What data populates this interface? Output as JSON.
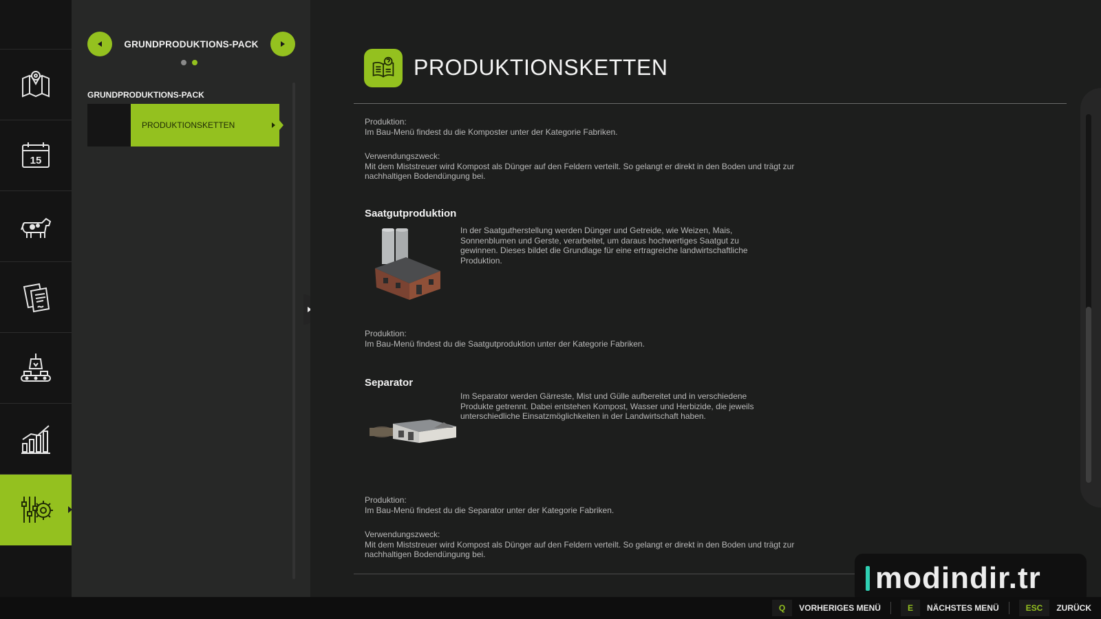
{
  "sidebar": {
    "items": [
      {
        "id": "map",
        "icon": "map-pin-icon"
      },
      {
        "id": "calendar",
        "icon": "calendar-icon",
        "day": "15"
      },
      {
        "id": "animals",
        "icon": "cow-icon"
      },
      {
        "id": "contracts",
        "icon": "contract-icon"
      },
      {
        "id": "production",
        "icon": "factory-conveyor-icon"
      },
      {
        "id": "statistics",
        "icon": "bar-chart-icon"
      },
      {
        "id": "settings",
        "icon": "settings-gear-icon",
        "active": true
      }
    ]
  },
  "subpanel": {
    "pager_title": "GRUNDPRODUKTIONS-PACK",
    "section_label": "GRUNDPRODUKTIONS-PACK",
    "list_item_label": "PRODUKTIONSKETTEN"
  },
  "main": {
    "title": "PRODUKTIONSKETTEN",
    "block1": {
      "prod_label": "Produktion:",
      "prod_text": "Im Bau-Menü findest du die Komposter unter der Kategorie Fabriken.",
      "use_label": "Verwendungszweck:",
      "use_text": "Mit dem Miststreuer wird Kompost als Dünger auf den Feldern verteilt. So gelangt er direkt in den Boden und trägt zur nachhaltigen Bodendüngung bei."
    },
    "saatgut": {
      "title": "Saatgutproduktion",
      "desc": "In der Saatgutherstellung werden Dünger und Getreide, wie Weizen, Mais, Sonnenblumen und Gerste, verarbeitet, um daraus hochwertiges Saatgut zu gewinnen. Dieses bildet die Grundlage für eine ertragreiche landwirtschaftliche Produktion.",
      "prod_label": "Produktion:",
      "prod_text": "Im Bau-Menü findest du die Saatgutproduktion unter der Kategorie Fabriken."
    },
    "separator": {
      "title": "Separator",
      "desc": "Im Separator werden Gärreste, Mist und Gülle aufbereitet und in verschiedene Produkte getrennt. Dabei entstehen Kompost, Wasser und Herbizide, die jeweils unterschiedliche Einsatzmöglichkeiten in der Landwirtschaft haben.",
      "prod_label": "Produktion:",
      "prod_text": "Im Bau-Menü findest du die Separator unter der Kategorie Fabriken.",
      "use_label": "Verwendungszweck:",
      "use_text": "Mit dem Miststreuer wird Kompost als Dünger auf den Feldern verteilt. So gelangt er direkt in den Boden und trägt zur nachhaltigen Bodendüngung bei."
    }
  },
  "watermark": {
    "text": "modindir.tr"
  },
  "bottombar": {
    "hints": [
      {
        "key": "Q",
        "label": "VORHERIGES MENÜ"
      },
      {
        "key": "E",
        "label": "NÄCHSTES MENÜ"
      },
      {
        "key": "ESC",
        "label": "ZURÜCK"
      }
    ]
  },
  "colors": {
    "accent": "#94c11f",
    "background": "#1d1e1d",
    "panel": "#272827",
    "sidebar": "#141414"
  }
}
